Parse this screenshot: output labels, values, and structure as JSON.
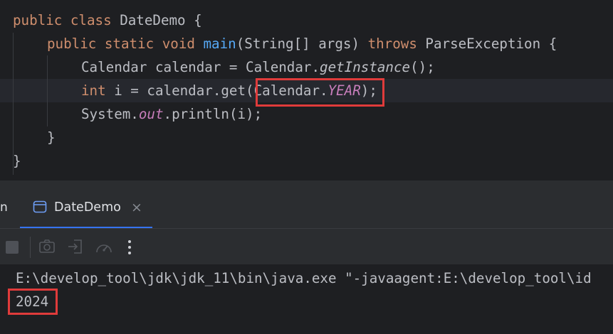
{
  "editor": {
    "line1": {
      "kw": "public class ",
      "name": "DateDemo {"
    },
    "line2": {
      "kw": "public static void ",
      "method": "main",
      "params": "(String[] args) ",
      "throws": "throws",
      "exc": " ParseException {"
    },
    "line3": {
      "pre": "Calendar calendar = Calendar.",
      "call": "getInstance",
      "post": "();"
    },
    "line4": {
      "kw": "int",
      "pre": " i = calendar.get",
      "open_paren": "(",
      "cls": "Calendar.",
      "field": "YEAR",
      "close_paren": ")",
      "semi": ";"
    },
    "line5": {
      "pre": "System.",
      "field": "out",
      "post": ".println(i);"
    },
    "line6": {
      "text": "}"
    },
    "line7": {
      "text": "}"
    }
  },
  "run_panel": {
    "left_clipped_label": "n",
    "tab_label": "DateDemo",
    "tab_close": "×",
    "toolbar_icons": [
      "stop-icon",
      "camera-icon",
      "import-icon",
      "gauge-icon",
      "more-icon"
    ]
  },
  "console": {
    "command": "E:\\develop_tool\\jdk\\jdk_11\\bin\\java.exe \"-javaagent:E:\\develop_tool\\id",
    "output": "2024"
  },
  "colors": {
    "background": "#1e1f22",
    "keyword": "#cf8e6d",
    "method": "#56a8f5",
    "static_field": "#c77dba",
    "text": "#bcbec4",
    "highlight_box": "#e03b3b",
    "tab_accent": "#3574f0"
  }
}
